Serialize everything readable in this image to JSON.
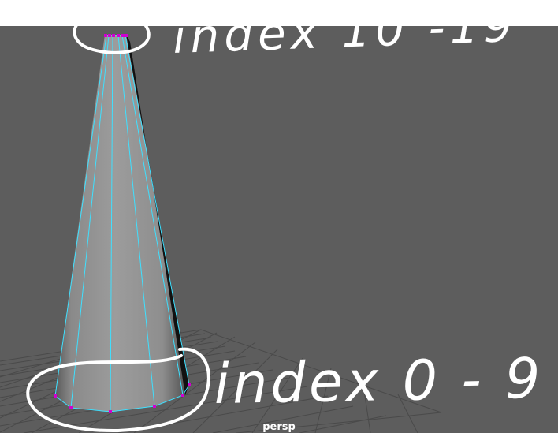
{
  "viewport": {
    "camera_label": "persp",
    "background_color": "#5d5d5d",
    "wireframe_color": "#3fe0ff",
    "vertex_color": "#d000d0",
    "annotation_color": "#ffffff"
  },
  "annotations": {
    "top_note": "index 10 -19",
    "bottom_note": "index 0 - 9"
  }
}
